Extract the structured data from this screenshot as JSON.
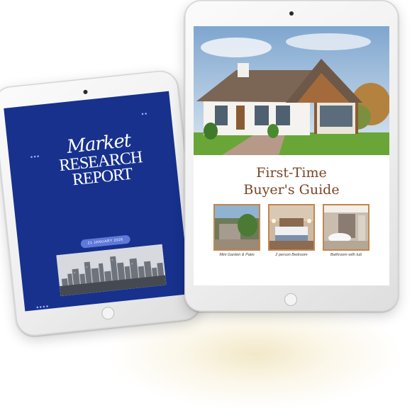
{
  "left_tablet": {
    "cover": {
      "title_script": "Market",
      "title_line1": "RESEARCH",
      "title_line2": "REPORT",
      "date": "21 JANUARY 2026",
      "decor_dots_1": "●●●",
      "decor_dots_2": "●●",
      "decor_dots_3": "●●●●"
    },
    "colors": {
      "cover_bg": "#17318d",
      "pill": "#5f79d8"
    }
  },
  "right_tablet": {
    "page": {
      "title_line1": "First-Time",
      "title_line2": "Buyer's Guide",
      "photos": [
        {
          "caption": "Mini Garden & Patio"
        },
        {
          "caption": "2 person Bedroom"
        },
        {
          "caption": "Bathroom with tub"
        }
      ]
    },
    "colors": {
      "title": "#7a4526",
      "frame": "#c3864f"
    }
  }
}
